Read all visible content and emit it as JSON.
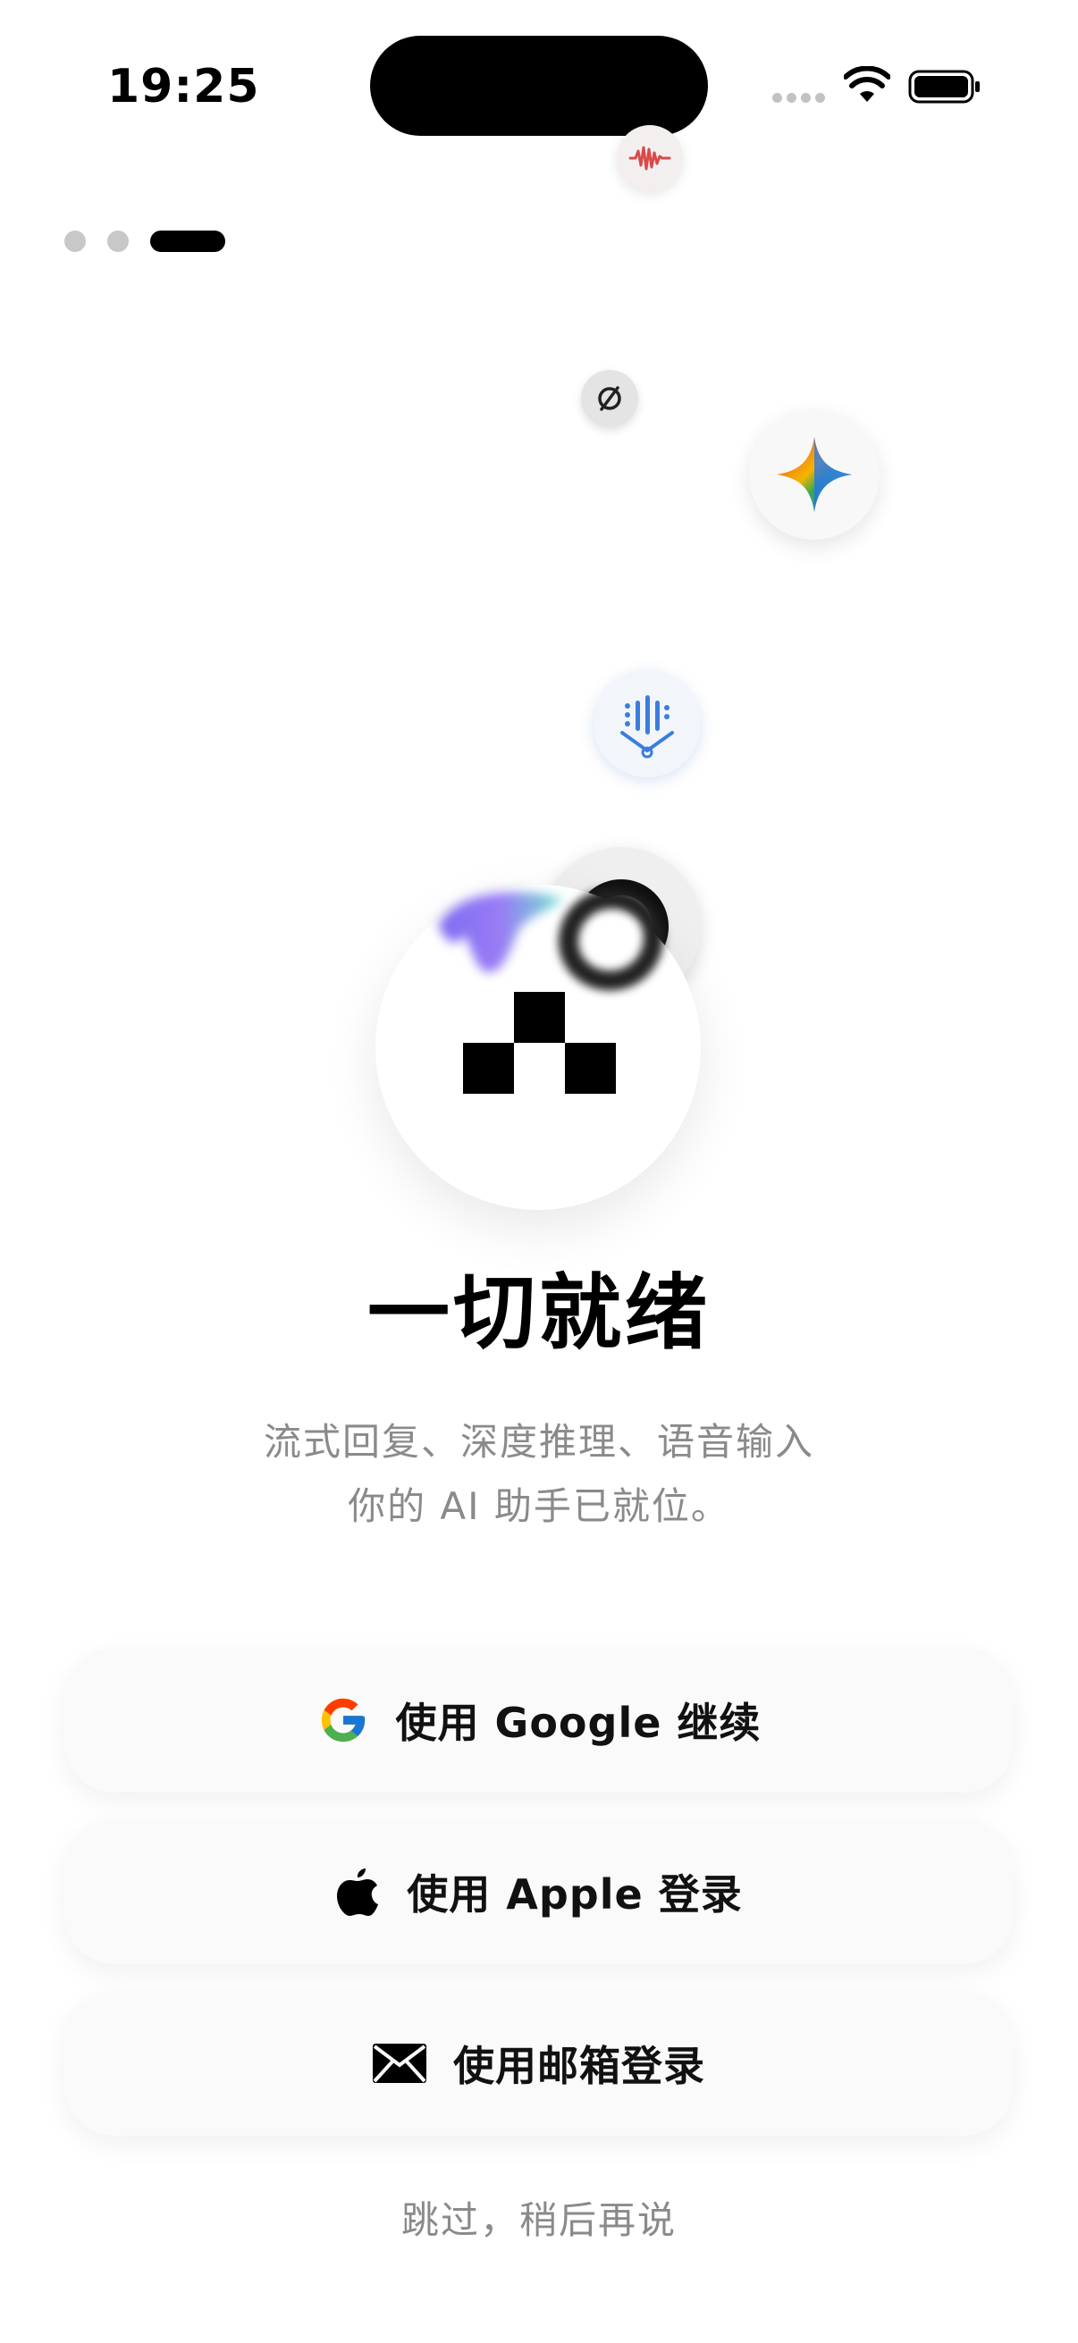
{
  "status_bar": {
    "time": "19:25"
  },
  "onboarding": {
    "page_count": 3,
    "active_page": 3,
    "headline": "一切就绪",
    "subtitle_line1": "流式回复、深度推理、语音输入",
    "subtitle_line2": "你的 AI 助手已就位。"
  },
  "icons": {
    "bubbles": [
      "waveform-icon",
      "slash-circle-icon",
      "gemini-sparkle-icon",
      "download-arrow-icon",
      "ring-logo-icon"
    ],
    "main": "checkerboard-logo-icon"
  },
  "auth": {
    "google_label": "使用 Google 继续",
    "apple_label": "使用 Apple 登录",
    "email_label": "使用邮箱登录",
    "skip_label": "跳过，稍后再说"
  },
  "colors": {
    "primary_text": "#000000",
    "secondary_text": "#8a8a8a",
    "button_bg": "#fafafa",
    "dot_inactive": "#c8c8c8",
    "dot_active": "#000000"
  }
}
